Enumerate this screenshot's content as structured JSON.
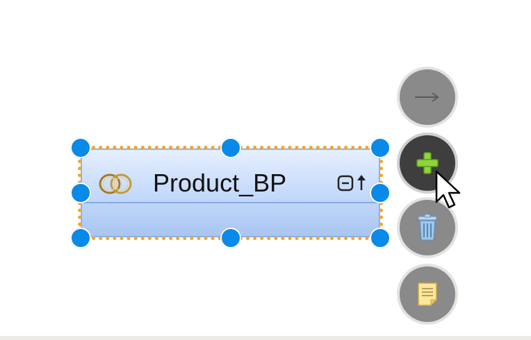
{
  "entity": {
    "name": "Product_BP",
    "icon": "linked-rings-icon",
    "header_icon": "collapse-toggle-icon"
  },
  "actions": [
    {
      "icon": "arrow-right-icon"
    },
    {
      "icon": "plus-icon"
    },
    {
      "icon": "trash-icon"
    },
    {
      "icon": "note-icon"
    }
  ],
  "colors": {
    "selection_border": "#f5a524",
    "handle": "#0a8ae8",
    "entity_gradient_top": "#e6efff",
    "entity_gradient_bottom": "#a9c6f1",
    "action_bubble": "#8a8a8a",
    "action_bubble_active": "#3e3e3e",
    "plus_green": "#8fd43a"
  }
}
